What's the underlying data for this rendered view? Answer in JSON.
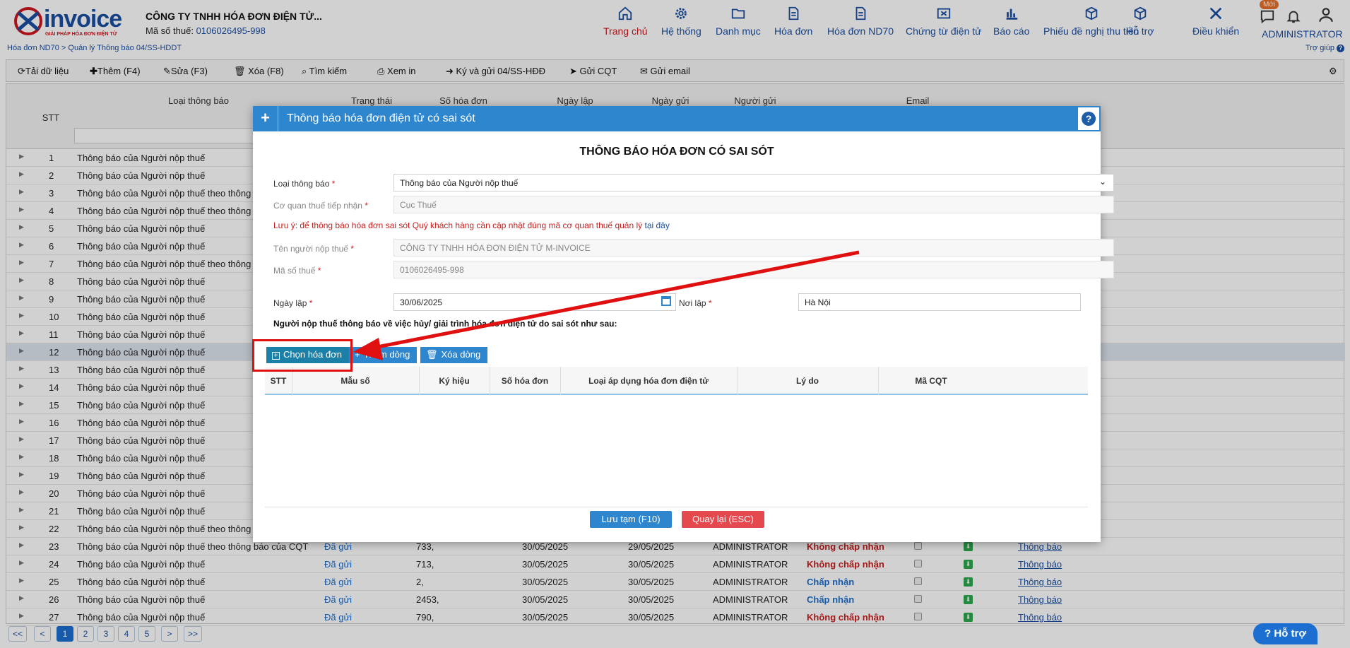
{
  "header": {
    "logo_text": "invoice",
    "logo_tagline": "GIẢI PHÁP HÓA ĐƠN ĐIỆN TỬ",
    "company": "CÔNG TY TNHH HÓA ĐƠN ĐIỆN TỬ...",
    "tax_label": "Mã số thuế:",
    "tax_value": "0106026495-998",
    "nav": [
      "Trang chủ",
      "Hệ thống",
      "Danh mục",
      "Hóa đơn",
      "Hóa đơn ND70",
      "Chứng từ điện tử",
      "Báo cáo",
      "Phiếu đề nghị thu tiền",
      "Hỗ trợ",
      "Điều khiển"
    ],
    "new_badge": "Mới",
    "user": "ADMINISTRATOR",
    "breadcrumb": "Hóa đơn ND70 > Quản lý Thông báo 04/SS-HDDT",
    "help": "Trợ giúp"
  },
  "toolbar": {
    "reload": "Tải dữ liệu",
    "add": "Thêm (F4)",
    "edit": "Sửa (F3)",
    "delete": "Xóa (F8)",
    "search": "Tìm kiếm",
    "print": "Xem in",
    "sign": "Ký và gửi 04/SS-HĐĐ",
    "send_cqt": "Gửi CQT",
    "send_email": "Gửi email"
  },
  "grid": {
    "headers": {
      "stt": "STT",
      "type": "Loại thông báo",
      "status": "Trạng thái",
      "number": "Số hóa đơn",
      "created": "Ngày lập",
      "sent": "Ngày gửi",
      "sender": "Người gửi",
      "email": "Email"
    },
    "rows": [
      {
        "stt": "1",
        "name": "Thông báo của Người nộp thuế"
      },
      {
        "stt": "2",
        "name": "Thông báo của Người nộp thuế"
      },
      {
        "stt": "3",
        "name": "Thông báo của Người nộp thuế theo thông bá"
      },
      {
        "stt": "4",
        "name": "Thông báo của Người nộp thuế theo thông bá"
      },
      {
        "stt": "5",
        "name": "Thông báo của Người nộp thuế"
      },
      {
        "stt": "6",
        "name": "Thông báo của Người nộp thuế"
      },
      {
        "stt": "7",
        "name": "Thông báo của Người nộp thuế theo thông bá"
      },
      {
        "stt": "8",
        "name": "Thông báo của Người nộp thuế"
      },
      {
        "stt": "9",
        "name": "Thông báo của Người nộp thuế"
      },
      {
        "stt": "10",
        "name": "Thông báo của Người nộp thuế"
      },
      {
        "stt": "11",
        "name": "Thông báo của Người nộp thuế"
      },
      {
        "stt": "12",
        "name": "Thông báo của Người nộp thuế"
      },
      {
        "stt": "13",
        "name": "Thông báo của Người nộp thuế"
      },
      {
        "stt": "14",
        "name": "Thông báo của Người nộp thuế"
      },
      {
        "stt": "15",
        "name": "Thông báo của Người nộp thuế"
      },
      {
        "stt": "16",
        "name": "Thông báo của Người nộp thuế"
      },
      {
        "stt": "17",
        "name": "Thông báo của Người nộp thuế"
      },
      {
        "stt": "18",
        "name": "Thông báo của Người nộp thuế"
      },
      {
        "stt": "19",
        "name": "Thông báo của Người nộp thuế"
      },
      {
        "stt": "20",
        "name": "Thông báo của Người nộp thuế"
      },
      {
        "stt": "21",
        "name": "Thông báo của Người nộp thuế"
      },
      {
        "stt": "22",
        "name": "Thông báo của Người nộp thuế theo thông bá"
      },
      {
        "stt": "23",
        "name": "Thông báo của Người nộp thuế theo thông báo của CQT",
        "status": "Đã gửi",
        "number": "733,",
        "created": "30/05/2025",
        "sent": "29/05/2025",
        "sender": "ADMINISTRATOR",
        "result": "Không chấp nhận",
        "link": "Thông báo"
      },
      {
        "stt": "24",
        "name": "Thông báo của Người nộp thuế",
        "status": "Đã gửi",
        "number": "713,",
        "created": "30/05/2025",
        "sent": "30/05/2025",
        "sender": "ADMINISTRATOR",
        "result": "Không chấp nhận",
        "link": "Thông báo"
      },
      {
        "stt": "25",
        "name": "Thông báo của Người nộp thuế",
        "status": "Đã gửi",
        "number": "2,",
        "created": "30/05/2025",
        "sent": "30/05/2025",
        "sender": "ADMINISTRATOR",
        "result": "Chấp nhận",
        "link": "Thông báo"
      },
      {
        "stt": "26",
        "name": "Thông báo của Người nộp thuế",
        "status": "Đã gửi",
        "number": "2453,",
        "created": "30/05/2025",
        "sent": "30/05/2025",
        "sender": "ADMINISTRATOR",
        "result": "Chấp nhận",
        "link": "Thông báo"
      },
      {
        "stt": "27",
        "name": "Thông báo của Người nộp thuế",
        "status": "Đã gửi",
        "number": "790,",
        "created": "30/05/2025",
        "sent": "30/05/2025",
        "sender": "ADMINISTRATOR",
        "result": "Không chấp nhận",
        "link": "Thông báo"
      }
    ]
  },
  "pager": {
    "first": "<<",
    "prev": "<",
    "pages": [
      "1",
      "2",
      "3",
      "4",
      "5"
    ],
    "next": ">",
    "last": ">>"
  },
  "support": "Hỗ trợ",
  "modal": {
    "header": "Thông báo hóa đơn điện tử có sai sót",
    "title": "THÔNG BÁO HÓA ĐƠN CÓ SAI SÓT",
    "type_label": "Loại thông báo",
    "type_value": "Thông báo của Người nộp thuế",
    "tax_office_label": "Cơ quan thuế tiếp nhận",
    "tax_office_value": "Cục Thuế",
    "note": "Lưu ý: để thông báo hóa đơn sai sót Quý khách hàng cần cập nhật đúng mã cơ quan thuế quản lý",
    "note_link": "tại đây",
    "payer_label": "Tên người nộp thuế",
    "payer_value": "CÔNG TY TNHH HÓA ĐƠN ĐIỆN TỬ M-INVOICE",
    "mst_label": "Mã số thuế",
    "mst_value": "0106026495-998",
    "date_label": "Ngày lập",
    "date_value": "30/06/2025",
    "place_label": "Nơi lập",
    "place_value": "Hà Nội",
    "paragraph": "Người nộp thuế thông báo về việc hủy/ giải trình hóa đơn điện tử do sai sót như sau:",
    "btn_choose": "Chọn hóa đơn",
    "btn_add_row": "Thêm dòng",
    "btn_del_row": "Xóa dòng",
    "cols": [
      "STT",
      "Mẫu số",
      "Ký hiệu",
      "Số hóa đơn",
      "Loại áp dụng hóa đơn điện tử",
      "Lý do",
      "Mã CQT"
    ],
    "save": "Lưu tạm (F10)",
    "back": "Quay lại (ESC)",
    "required": "*"
  },
  "colors": {
    "brand": "#1c4fa1",
    "accent": "#2e86cf",
    "danger": "#c81e1e",
    "highlight": "#e01010"
  }
}
